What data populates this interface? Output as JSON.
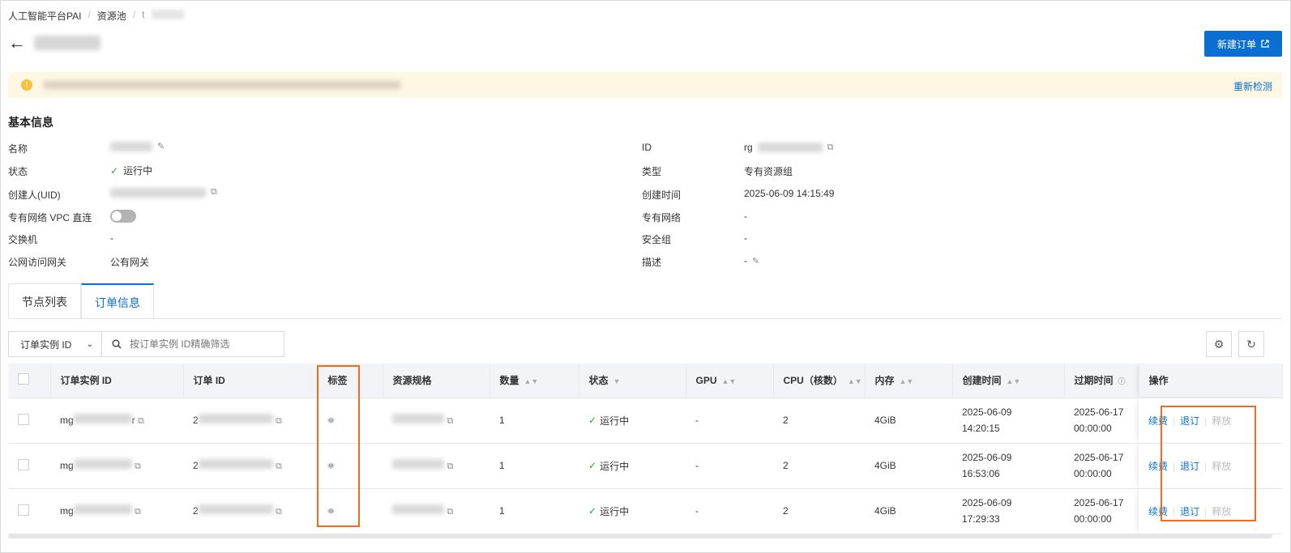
{
  "breadcrumb": {
    "item1": "人工智能平台PAI",
    "item2": "资源池",
    "item3": "t"
  },
  "header": {
    "new_order": "新建订单",
    "new_order_icon": "external-link-icon"
  },
  "banner": {
    "recheck": "重新检测"
  },
  "basic": {
    "title": "基本信息",
    "name_label": "名称",
    "status_label": "状态",
    "status_value": "运行中",
    "creator_label": "创建人(UID)",
    "vpc_direct_label": "专有网络 VPC 直连",
    "vpc_direct_on": false,
    "switch_label": "交换机",
    "switch_value": "-",
    "gateway_label": "公网访问网关",
    "gateway_value": "公有网关",
    "id_label": "ID",
    "id_value": "rg",
    "type_label": "类型",
    "type_value": "专有资源组",
    "created_label": "创建时间",
    "created_value": "2025-06-09 14:15:49",
    "vpc_label": "专有网络",
    "vpc_value": "-",
    "sg_label": "安全组",
    "sg_value": "-",
    "desc_label": "描述",
    "desc_value": "-"
  },
  "tabs": {
    "nodes": "节点列表",
    "orders": "订单信息"
  },
  "filter": {
    "select_value": "订单实例 ID",
    "placeholder": "按订单实例 ID精确筛选"
  },
  "table": {
    "headers": {
      "instance": "订单实例 ID",
      "order": "订单 ID",
      "tag": "标签",
      "spec": "资源规格",
      "count": "数量",
      "status": "状态",
      "gpu": "GPU",
      "cpu": "CPU（核数）",
      "mem": "内存",
      "created": "创建时间",
      "expire": "过期时间",
      "ops": "操作"
    },
    "rows": [
      {
        "instance": "mg",
        "inst_tail": "r",
        "order": "2",
        "count": "1",
        "status": "运行中",
        "gpu": "-",
        "cpu": "2",
        "mem": "4GiB",
        "created_date": "2025-06-09",
        "created_time": "14:20:15",
        "expire_date": "2025-06-17",
        "expire_time": "00:00:00",
        "renew": "续费",
        "unsubscribe": "退订",
        "release": "释放"
      },
      {
        "instance": "mg",
        "inst_tail": "",
        "order": "2",
        "count": "1",
        "status": "运行中",
        "gpu": "-",
        "cpu": "2",
        "mem": "4GiB",
        "created_date": "2025-06-09",
        "created_time": "16:53:06",
        "expire_date": "2025-06-17",
        "expire_time": "00:00:00",
        "renew": "续费",
        "unsubscribe": "退订",
        "release": "释放"
      },
      {
        "instance": "mg",
        "inst_tail": "",
        "order": "2",
        "count": "1",
        "status": "运行中",
        "gpu": "-",
        "cpu": "2",
        "mem": "4GiB",
        "created_date": "2025-06-09",
        "created_time": "17:29:33",
        "expire_date": "2025-06-17",
        "expire_time": "00:00:00",
        "renew": "续费",
        "unsubscribe": "退订",
        "release": "释放"
      }
    ]
  },
  "colors": {
    "accent": "#0a6fd1",
    "success": "#2a9d3a",
    "highlight": "#f26b1d",
    "banner_bg": "#fdf7e3"
  }
}
